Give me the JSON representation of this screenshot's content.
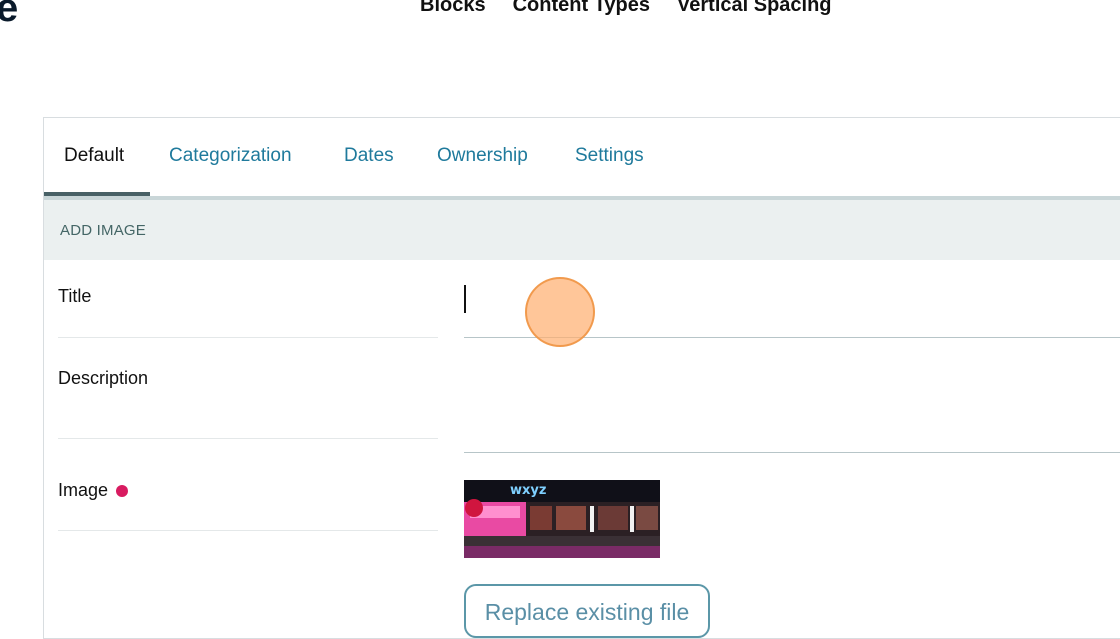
{
  "header": {
    "logo_fragment": "e",
    "nav": [
      "Blocks",
      "Content Types",
      "Vertical Spacing"
    ]
  },
  "tabs": [
    {
      "label": "Default",
      "active": true
    },
    {
      "label": "Categorization",
      "active": false
    },
    {
      "label": "Dates",
      "active": false
    },
    {
      "label": "Ownership",
      "active": false
    },
    {
      "label": "Settings",
      "active": false
    }
  ],
  "section": {
    "title": "ADD IMAGE"
  },
  "fields": {
    "title": {
      "label": "Title",
      "value": ""
    },
    "description": {
      "label": "Description",
      "value": ""
    },
    "image": {
      "label": "Image",
      "required": true,
      "thumbnail_text": "wxyz"
    }
  },
  "replace_button": {
    "label": "Replace existing file"
  },
  "colors": {
    "tab_link": "#1f7a9c",
    "required_dot": "#d81b60",
    "band": "#ebf0f0",
    "button_border": "#5b97a8"
  }
}
